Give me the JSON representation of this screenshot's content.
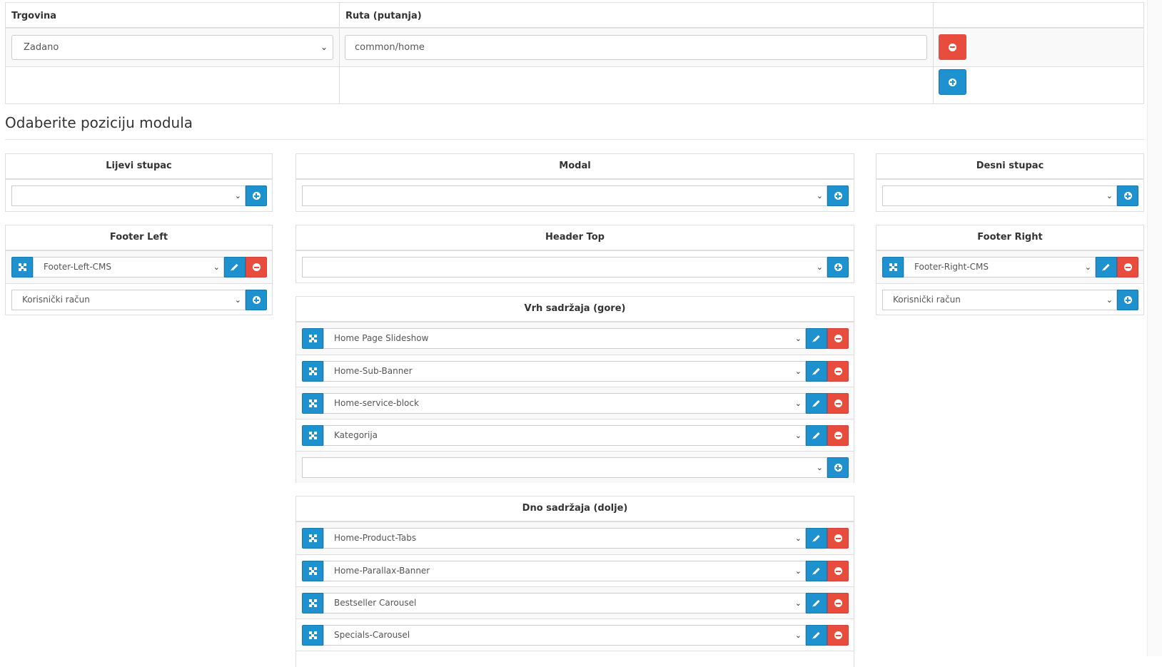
{
  "route_table": {
    "headers": {
      "store": "Trgovina",
      "route": "Ruta (putanja)"
    },
    "row": {
      "store_value": "Zadano",
      "route_value": "common/home"
    }
  },
  "legend": "Odaberite poziciju modula",
  "positions": {
    "column_left": {
      "title": "Lijevi stupac",
      "modules": [],
      "add_value": ""
    },
    "modal": {
      "title": "Modal",
      "modules": [],
      "add_value": ""
    },
    "column_right": {
      "title": "Desni stupac",
      "modules": [],
      "add_value": ""
    },
    "footer_left": {
      "title": "Footer Left",
      "modules": [
        "Footer-Left-CMS"
      ],
      "add_value": "Korisnički račun"
    },
    "header_top": {
      "title": "Header Top",
      "modules": [],
      "add_value": ""
    },
    "footer_right": {
      "title": "Footer Right",
      "modules": [
        "Footer-Right-CMS"
      ],
      "add_value": "Korisnički račun"
    },
    "content_top": {
      "title": "Vrh sadržaja (gore)",
      "modules": [
        "Home Page Slideshow",
        "Home-Sub-Banner",
        "Home-service-block",
        "Kategorija"
      ],
      "add_value": ""
    },
    "content_bottom": {
      "title": "Dno sadržaja (dolje)",
      "modules": [
        "Home-Product-Tabs",
        "Home-Parallax-Banner",
        "Bestseller Carousel",
        "Specials-Carousel"
      ],
      "add_value": ""
    }
  },
  "colors": {
    "primary": "#1e91cf",
    "danger": "#e74c3c",
    "border": "#dddddd"
  },
  "icons": {
    "remove": "minus-circle-icon",
    "add": "plus-circle-icon",
    "edit": "pencil-icon",
    "drag": "arrows-icon",
    "dropdown": "chevron-down-icon"
  }
}
